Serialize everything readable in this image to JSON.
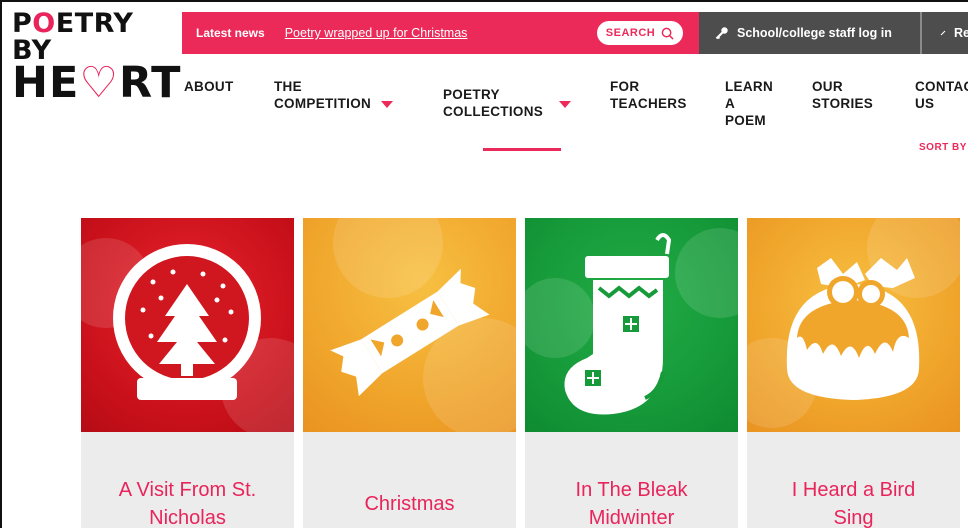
{
  "logo": {
    "line1": "POETRY BY",
    "line2": "HEART"
  },
  "topbar": {
    "latest_label": "Latest news",
    "latest_link": "Poetry wrapped up for Christmas",
    "search_label": "SEARCH",
    "staff_login": "School/college staff log in",
    "register_label": "Re"
  },
  "nav": {
    "about": "ABOUT",
    "competition_l1": "THE",
    "competition_l2": "COMPETITION",
    "collections_l1": "POETRY",
    "collections_l2": "COLLECTIONS",
    "teachers_l1": "FOR",
    "teachers_l2": "TEACHERS",
    "learn_l1": "LEARN",
    "learn_l2": "A",
    "learn_l3": "POEM",
    "stories_l1": "OUR",
    "stories_l2": "STORIES",
    "contact_l1": "CONTAC",
    "contact_l2": "US"
  },
  "sort_label": "SORT BY",
  "cards": [
    {
      "title_l1": "A Visit From St.",
      "title_l2": "Nicholas",
      "icon": "snow-globe-icon",
      "color": "#d9141f"
    },
    {
      "title_l1": "Christmas",
      "title_l2": "",
      "icon": "cracker-icon",
      "color": "#f0a52b"
    },
    {
      "title_l1": "In The Bleak",
      "title_l2": "Midwinter",
      "icon": "stocking-icon",
      "color": "#159a3a"
    },
    {
      "title_l1": "I Heard a Bird",
      "title_l2": "Sing",
      "icon": "christmas-pudding-icon",
      "color": "#f0a52b"
    }
  ],
  "colors": {
    "accent": "#ec2a5a",
    "dark": "#4d4d4d"
  }
}
